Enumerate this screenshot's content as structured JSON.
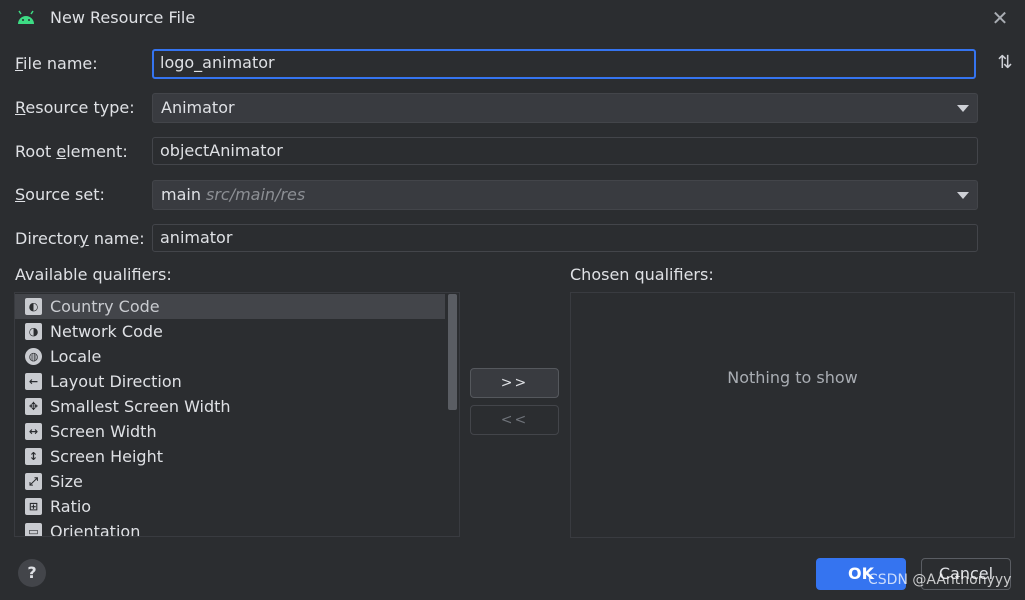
{
  "window": {
    "title": "New Resource File",
    "close_label": "✕"
  },
  "form": {
    "file_name": {
      "label": "File name:",
      "mnemonic": "F",
      "value": "logo_animator"
    },
    "resource_type": {
      "label": "Resource type:",
      "mnemonic": "R",
      "value": "Animator"
    },
    "root_element": {
      "label": "Root element:",
      "mnemonic": "e",
      "value": "objectAnimator"
    },
    "source_set": {
      "label": "Source set:",
      "mnemonic": "S",
      "value": "main",
      "hint": "src/main/res"
    },
    "directory_name": {
      "label": "Directory name:",
      "mnemonic": "y",
      "value": "animator"
    }
  },
  "qualifiers": {
    "available_label": "Available qualifiers:",
    "chosen_label": "Chosen qualifiers:",
    "available": [
      {
        "label": "Country Code",
        "icon": "country-code-icon",
        "glyph": "◐",
        "selected": true
      },
      {
        "label": "Network Code",
        "icon": "network-code-icon",
        "glyph": "◑"
      },
      {
        "label": "Locale",
        "icon": "locale-globe-icon",
        "glyph": "◍"
      },
      {
        "label": "Layout Direction",
        "icon": "layout-direction-icon",
        "glyph": "←"
      },
      {
        "label": "Smallest Screen Width",
        "icon": "smallest-screen-width-icon",
        "glyph": "✥"
      },
      {
        "label": "Screen Width",
        "icon": "screen-width-icon",
        "glyph": "↔"
      },
      {
        "label": "Screen Height",
        "icon": "screen-height-icon",
        "glyph": "↕"
      },
      {
        "label": "Size",
        "icon": "size-icon",
        "glyph": "⤢"
      },
      {
        "label": "Ratio",
        "icon": "ratio-icon",
        "glyph": "⊞"
      },
      {
        "label": "Orientation",
        "icon": "orientation-icon",
        "glyph": "▭"
      }
    ],
    "chosen_empty_text": "Nothing to show",
    "add_button": ">>",
    "remove_button": "<<"
  },
  "footer": {
    "help_label": "?",
    "ok_label": "OK",
    "cancel_label": "Cancel"
  },
  "watermark": "CSDN @AAnthonyyy",
  "colors": {
    "accent": "#3574f0",
    "background": "#2b2d30"
  }
}
